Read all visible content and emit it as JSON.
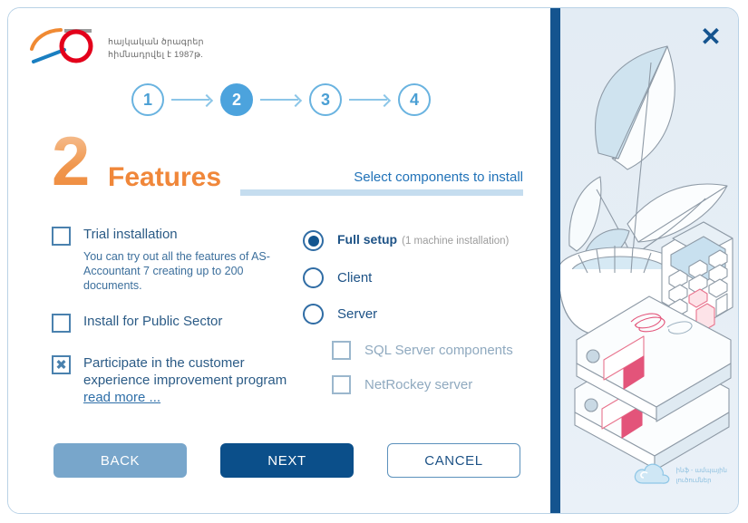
{
  "window": {
    "close_label": "✕"
  },
  "logo": {
    "icon": "as-logo-icon",
    "line1": "հայկական ծրագրեր",
    "line2": "հիմնադրվել է 1987թ."
  },
  "steps": {
    "items": [
      {
        "label": "1",
        "active": false
      },
      {
        "label": "2",
        "active": true
      },
      {
        "label": "3",
        "active": false
      },
      {
        "label": "4",
        "active": false
      }
    ]
  },
  "header": {
    "step_number": "2",
    "title": "Features",
    "subtitle": "Select components to install"
  },
  "options": {
    "left": {
      "trial": {
        "label": "Trial installation",
        "checked": false,
        "description": "You can try out all the features of AS-Accountant 7 creating up to 200 documents."
      },
      "public_sector": {
        "label": "Install for Public Sector",
        "checked": false
      },
      "customer_experience": {
        "label": "Participate in the customer experience improvement program",
        "checked": true,
        "link_label": "read more ..."
      }
    },
    "right": {
      "radios": [
        {
          "label": "Full setup",
          "note": "(1 machine installation)",
          "selected": true
        },
        {
          "label": "Client",
          "note": "",
          "selected": false
        },
        {
          "label": "Server",
          "note": "",
          "selected": false
        }
      ],
      "sub_checkboxes": [
        {
          "label": "SQL Server components",
          "checked": false,
          "disabled": true
        },
        {
          "label": "NetRockey server",
          "checked": false,
          "disabled": true
        }
      ]
    }
  },
  "buttons": {
    "back": "BACK",
    "next": "NEXT",
    "cancel": "CANCEL"
  },
  "footer": {
    "cloud_icon": "cloud-icon",
    "line1": "ինֆ - ամպային",
    "line2": "լուծումներ"
  },
  "colors": {
    "accent_blue": "#0b4f8a",
    "step_blue": "#4ca3dd",
    "orange": "#f0873a",
    "divider": "#14548f"
  }
}
